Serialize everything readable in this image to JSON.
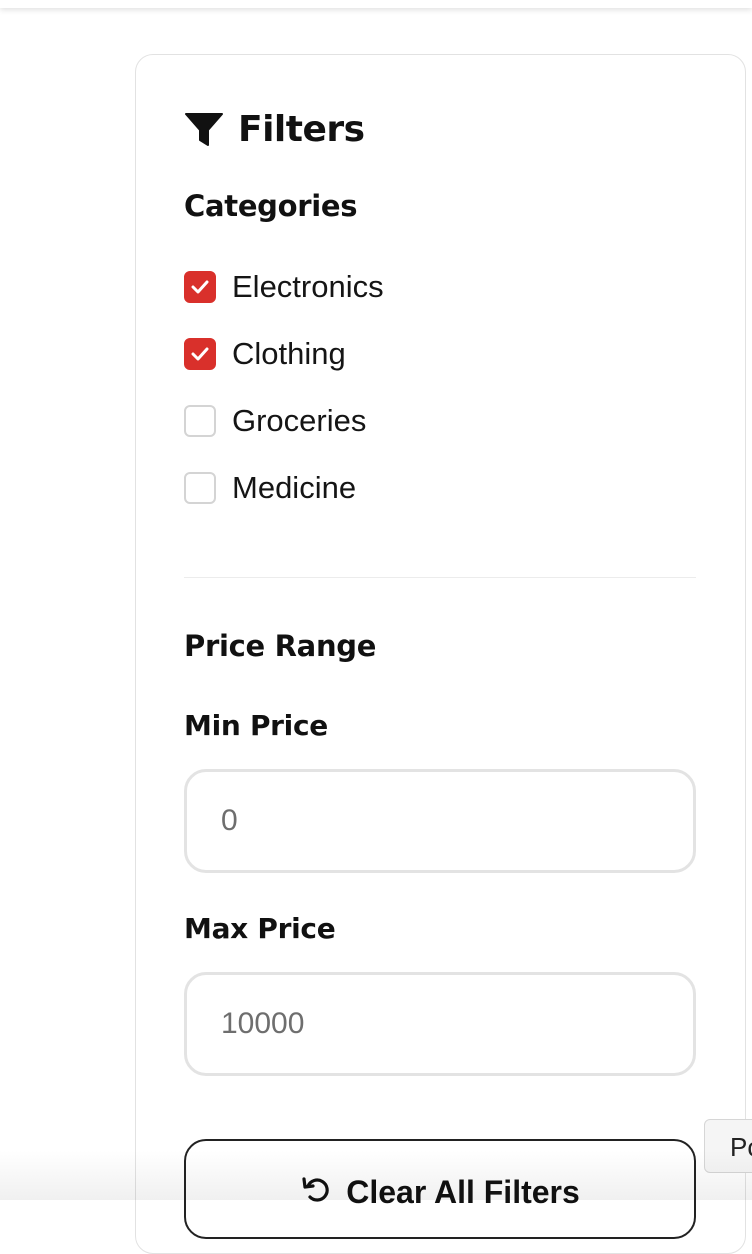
{
  "filters": {
    "title": "Filters",
    "icon": "filter-funnel-icon",
    "categories": {
      "heading": "Categories",
      "items": [
        {
          "label": "Electronics",
          "checked": true
        },
        {
          "label": "Clothing",
          "checked": true
        },
        {
          "label": "Groceries",
          "checked": false
        },
        {
          "label": "Medicine",
          "checked": false
        }
      ]
    },
    "price_range": {
      "heading": "Price Range",
      "min_label": "Min Price",
      "min_placeholder": "0",
      "max_label": "Max Price",
      "max_placeholder": "10000"
    },
    "clear_button": {
      "label": "Clear All Filters",
      "icon": "reset-icon"
    }
  },
  "side_tab": {
    "label": "Po"
  },
  "colors": {
    "accent": "#d9302b",
    "border": "#e2e2e2",
    "text": "#111111"
  }
}
